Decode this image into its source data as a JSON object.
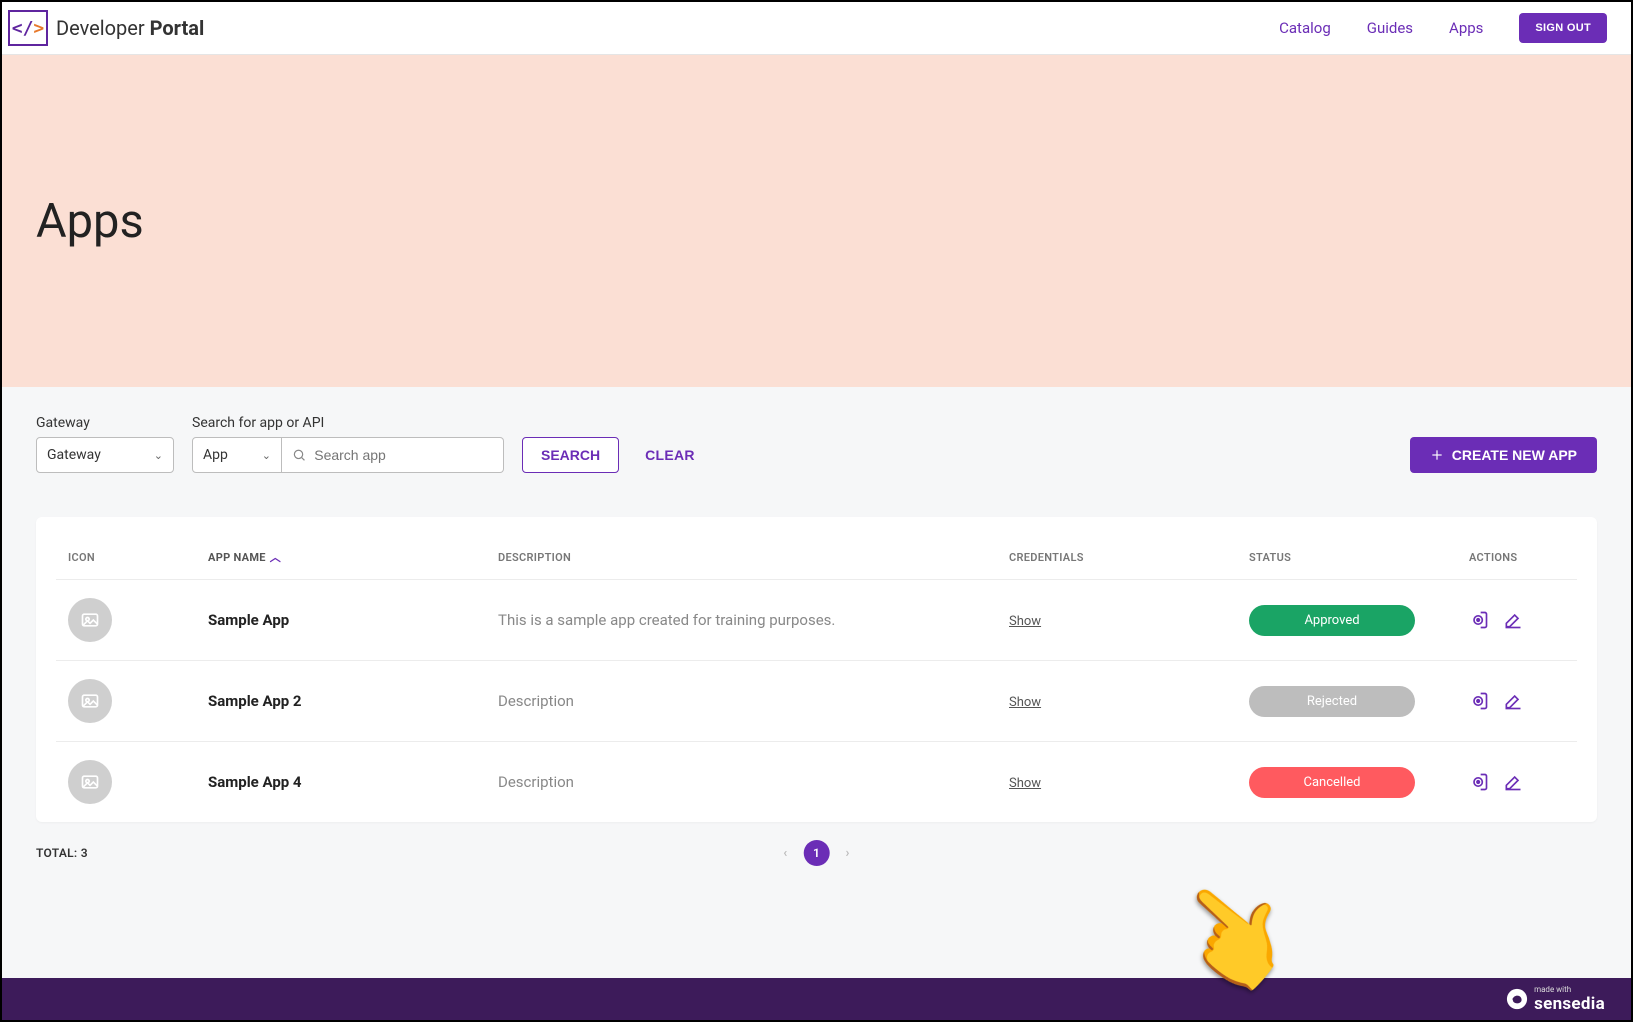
{
  "header": {
    "brand_prefix": "Developer ",
    "brand_bold": "Portal",
    "nav": [
      "Catalog",
      "Guides",
      "Apps"
    ],
    "signout": "SIGN OUT"
  },
  "hero": {
    "title": "Apps"
  },
  "filters": {
    "gateway_label": "Gateway",
    "gateway_value": "Gateway",
    "search_label": "Search for app or API",
    "type_value": "App",
    "search_placeholder": "Search app",
    "search_btn": "SEARCH",
    "clear_btn": "CLEAR",
    "create_btn": "CREATE NEW APP"
  },
  "table": {
    "columns": {
      "icon": "ICON",
      "name": "APP NAME",
      "desc": "DESCRIPTION",
      "cred": "CREDENTIALS",
      "status": "STATUS",
      "actions": "ACTIONS"
    },
    "rows": [
      {
        "name": "Sample App",
        "desc": "This is a sample app created for training purposes.",
        "cred": "Show",
        "status": "Approved"
      },
      {
        "name": "Sample App 2",
        "desc": "Description",
        "cred": "Show",
        "status": "Rejected"
      },
      {
        "name": "Sample App 4",
        "desc": "Description",
        "cred": "Show",
        "status": "Cancelled"
      }
    ]
  },
  "footer": {
    "total_label": "TOTAL: 3",
    "page": "1"
  },
  "bottom": {
    "made": "made with",
    "brand": "sensedia"
  }
}
